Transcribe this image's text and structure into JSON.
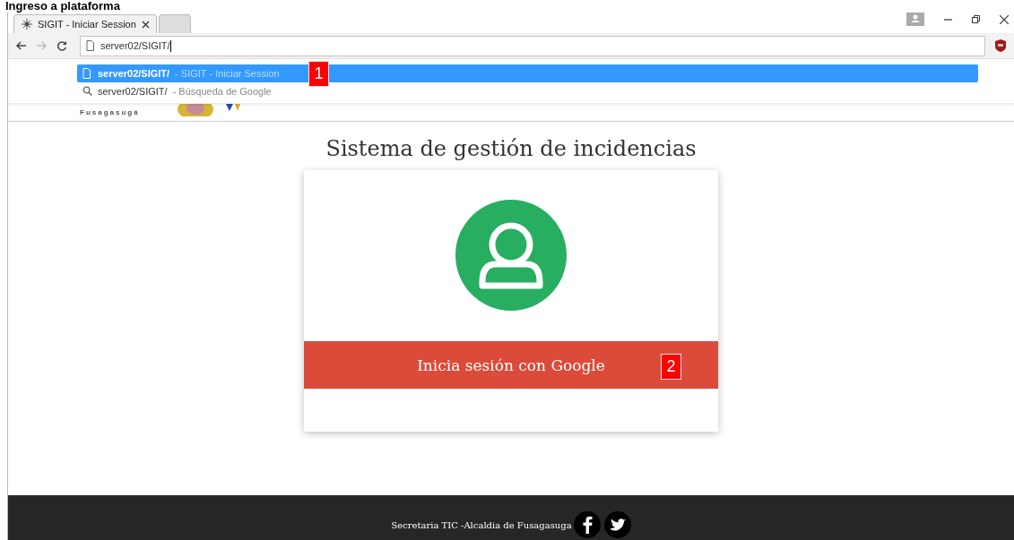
{
  "heading": "Ingreso a plataforma",
  "browser": {
    "tabs": [
      {
        "title": "SIGIT - Iniciar Session",
        "selected": true
      },
      {
        "selected": false
      }
    ],
    "address": {
      "value": "server02/SIGIT/"
    },
    "suggestions": [
      {
        "kind": "page",
        "url": "server02/SIGIT/",
        "description": "- SIGIT - Iniciar Session",
        "selected": true
      },
      {
        "kind": "search",
        "url": "server02/SIGIT/",
        "description": "- Búsqueda de Google",
        "selected": false
      }
    ]
  },
  "site": {
    "logo_text": "Fusagasugá",
    "title": "Sistema de gestión de incidencias",
    "login_button": "Inicia sesión con Google",
    "footer": "Secretaria TIC -Alcaldia de Fusagasuga"
  },
  "callouts": [
    "1",
    "2"
  ]
}
